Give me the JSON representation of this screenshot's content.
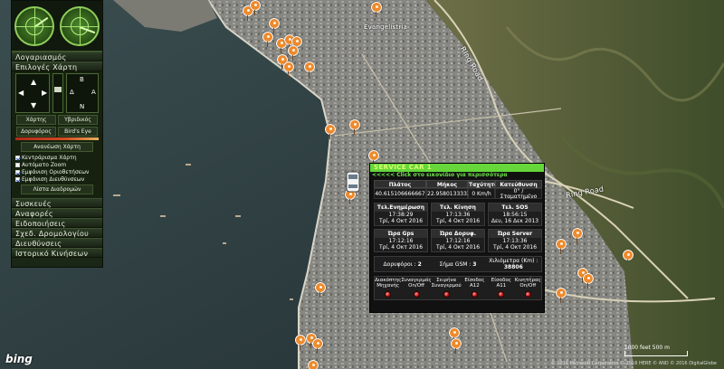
{
  "map": {
    "labels": {
      "ring_road_1": "Ring Road",
      "ring_road_2": "Ring Road",
      "district": "Evangelistria"
    },
    "brand": "bing",
    "copyright": "© 2016 Microsoft Corporation © 2016 HERE © AND © 2016 DigitalGlobe",
    "scale_label": "1000 feet  500 m",
    "pin_color": "#ee8a2c"
  },
  "sidebar": {
    "account_label": "Λογαριασμός",
    "map_options_label": "Επιλογές Χάρτη",
    "compass_letters": {
      "north": "Β",
      "west": "Δ",
      "east": "Α",
      "south": "Ν"
    },
    "view_buttons": [
      "Χάρτης",
      "Υβριδικός",
      "Δορυφόρος",
      "Bird's Eye"
    ],
    "refresh_label": "Ανανέωση Χάρτη",
    "options": [
      {
        "label": "Κεντράρισμα Χάρτη",
        "checked": true
      },
      {
        "label": "Αυτόματο Zoom",
        "checked": false
      },
      {
        "label": "Εμφάνιση Οριοθετήσεων",
        "checked": true
      },
      {
        "label": "Εμφάνιση Διευθύνσεων",
        "checked": true
      }
    ],
    "route_list_label": "Λίστα Διαδρομών",
    "menu": [
      "Συσκευές",
      "Αναφορές",
      "Ειδοποιήσεις",
      "Σχεδ. Δρομολογίου",
      "Διευθύνσεις",
      "Ιστορικό Κινήσεων"
    ]
  },
  "popup": {
    "title": "SERVICE CAR 1",
    "subtitle": "<<<<< Click στο εικονίδιο για περισσότερα",
    "columns": [
      "Πλάτος",
      "Μήκος",
      "Ταχύτητα",
      "Κατεύθυνση"
    ],
    "values": [
      "40.615106666667",
      "22.958013333333",
      "0 Km/h",
      "0° / Σταματημένο"
    ],
    "stats": [
      {
        "title": "Τελ.Ενημέρωση",
        "time": "17:38:29",
        "date": "Τρί, 4 Οκτ 2016"
      },
      {
        "title": "Τελ. Κίνηση",
        "time": "17:13:36",
        "date": "Τρί, 4 Οκτ 2016"
      },
      {
        "title": "Τελ. SOS",
        "time": "18:56:15",
        "date": "Δευ, 16 Δεκ 2013"
      },
      {
        "title": "Ώρα Gps",
        "time": "17:12:16",
        "date": "Τρί, 4 Οκτ 2016"
      },
      {
        "title": "Ώρα Δορυφ.",
        "time": "17:12:16",
        "date": "Τρί, 4 Οκτ 2016"
      },
      {
        "title": "Ώρα Server",
        "time": "17:13:36",
        "date": "Τρί, 4 Οκτ 2016"
      }
    ],
    "satellites_label": "Δορυφόροι :",
    "satellites_value": "2",
    "gsm_label": "Σήμα GSM :",
    "gsm_value": "3",
    "km_label": "Χιλιόμετρα (Km) :",
    "km_value": "38806",
    "io": [
      {
        "line1": "Διακόπτης",
        "line2": "Μηχανής"
      },
      {
        "line1": "Συναγερμός",
        "line2": "On/Off"
      },
      {
        "line1": "Σειρήνα",
        "line2": "Συναγερμού"
      },
      {
        "line1": "Είσοδος",
        "line2": "A12"
      },
      {
        "line1": "Είσοδος",
        "line2": "A11"
      },
      {
        "line1": "Κινητήρας",
        "line2": "On/Off"
      }
    ]
  }
}
